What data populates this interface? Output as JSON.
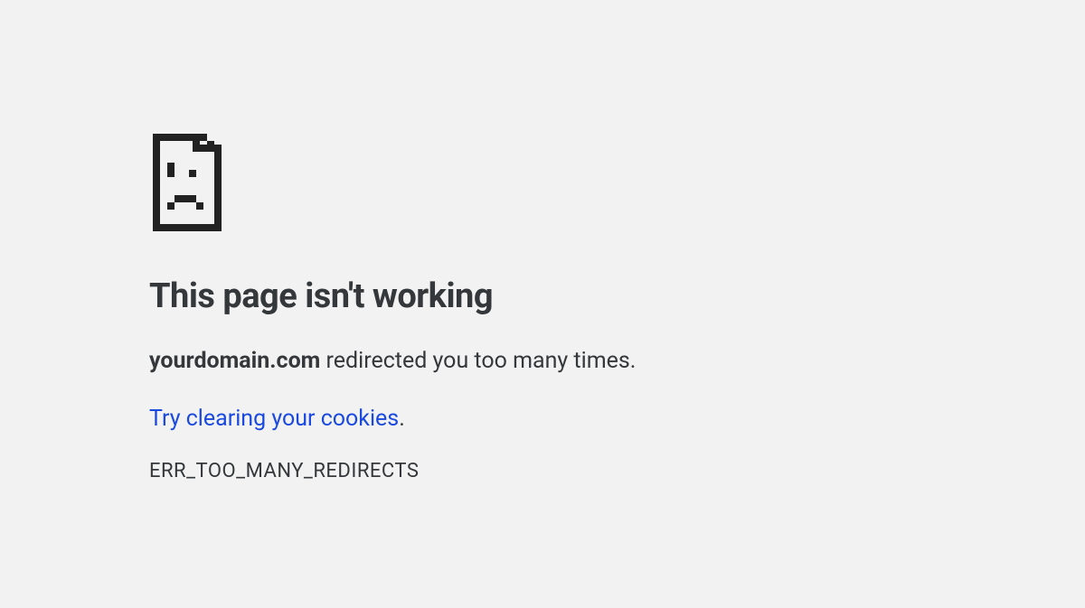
{
  "error": {
    "title": "This page isn't working",
    "domain": "yourdomain.com",
    "message_suffix": " redirected you too many times.",
    "suggestion_link": "Try clearing your cookies",
    "suggestion_period": ".",
    "code": "ERR_TOO_MANY_REDIRECTS"
  }
}
